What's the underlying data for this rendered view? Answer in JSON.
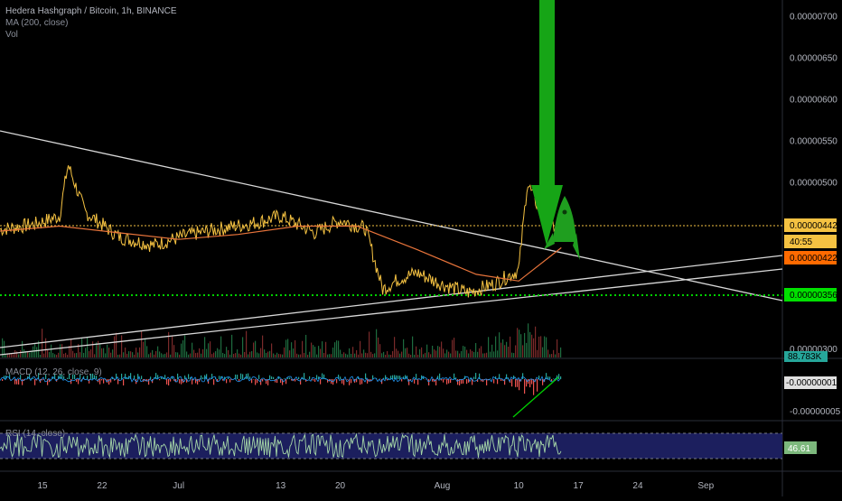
{
  "header": {
    "title": "Hedera Hashgraph / Bitcoin, 1h, BINANCE",
    "ma_label": "MA (200, close)",
    "vol_label": "Vol"
  },
  "indicators": {
    "macd_label": "MACD (12, 26, close, 9)",
    "rsi_label": "RSI (14, close)"
  },
  "chart_data": {
    "type": "line",
    "title": "Hedera Hashgraph / Bitcoin, 1h, BINANCE",
    "price_axis": {
      "ticks": [
        "0.00000700",
        "0.00000650",
        "0.00000600",
        "0.00000550",
        "0.00000500",
        "0.00000300"
      ],
      "ylim": [
        2.9e-06,
        7.2e-06
      ]
    },
    "x_ticks": [
      "15",
      "22",
      "Jul",
      "13",
      "20",
      "Aug",
      "10",
      "17",
      "24",
      "Sep"
    ],
    "series": [
      {
        "name": "close",
        "color": "#f5c242",
        "x": [
          "Jun 10",
          "Jun 14",
          "Jun 17",
          "Jun 18",
          "Jun 20",
          "Jun 24",
          "Jun 28",
          "Jul 2",
          "Jul 6",
          "Jul 10",
          "Jul 13",
          "Jul 17",
          "Jul 20",
          "Jul 23",
          "Jul 25",
          "Jul 27",
          "Jul 29",
          "Aug 1",
          "Aug 4",
          "Aug 7",
          "Aug 10",
          "Aug 11",
          "Aug 13",
          "Aug 15"
        ],
        "values": [
          4.44e-06,
          4.5e-06,
          4.6e-06,
          5.22e-06,
          4.65e-06,
          4.35e-06,
          4.25e-06,
          4.37e-06,
          4.45e-06,
          4.52e-06,
          4.6e-06,
          4.4e-06,
          4.55e-06,
          4.45e-06,
          3.72e-06,
          3.85e-06,
          3.92e-06,
          3.78e-06,
          3.68e-06,
          3.78e-06,
          3.95e-06,
          5e-06,
          4.55e-06,
          4.42e-06
        ]
      },
      {
        "name": "MA (200, close)",
        "color": "#e8743b",
        "x": [
          "Jun 10",
          "Jun 17",
          "Jun 24",
          "Jul 1",
          "Jul 8",
          "Jul 15",
          "Jul 22",
          "Jul 29",
          "Aug 5",
          "Aug 10",
          "Aug 15"
        ],
        "values": [
          4.42e-06,
          4.48e-06,
          4.4e-06,
          4.32e-06,
          4.38e-06,
          4.48e-06,
          4.48e-06,
          4.2e-06,
          3.9e-06,
          3.82e-06,
          4.22e-06
        ]
      }
    ],
    "price_labels": [
      {
        "value": "0.00000442",
        "bg": "#f5c242",
        "fg": "#000000"
      },
      {
        "value": "40:55",
        "bg": "#f5c242",
        "fg": "#000000"
      },
      {
        "value": "0.00000422",
        "bg": "#ff6a00",
        "fg": "#000000"
      },
      {
        "value": "0.00000356",
        "bg": "#00e000",
        "fg": "#000000"
      }
    ],
    "volume_label": "88.783K",
    "macd_ticks": [
      "-0.00000001",
      "-0.00000005"
    ],
    "rsi_value": "46.61",
    "colors": {
      "up": "#26a69a",
      "down": "#ef5350",
      "support": "#00d000",
      "arrow": "#16a516",
      "rsi_band": "#1c1f5e"
    }
  }
}
